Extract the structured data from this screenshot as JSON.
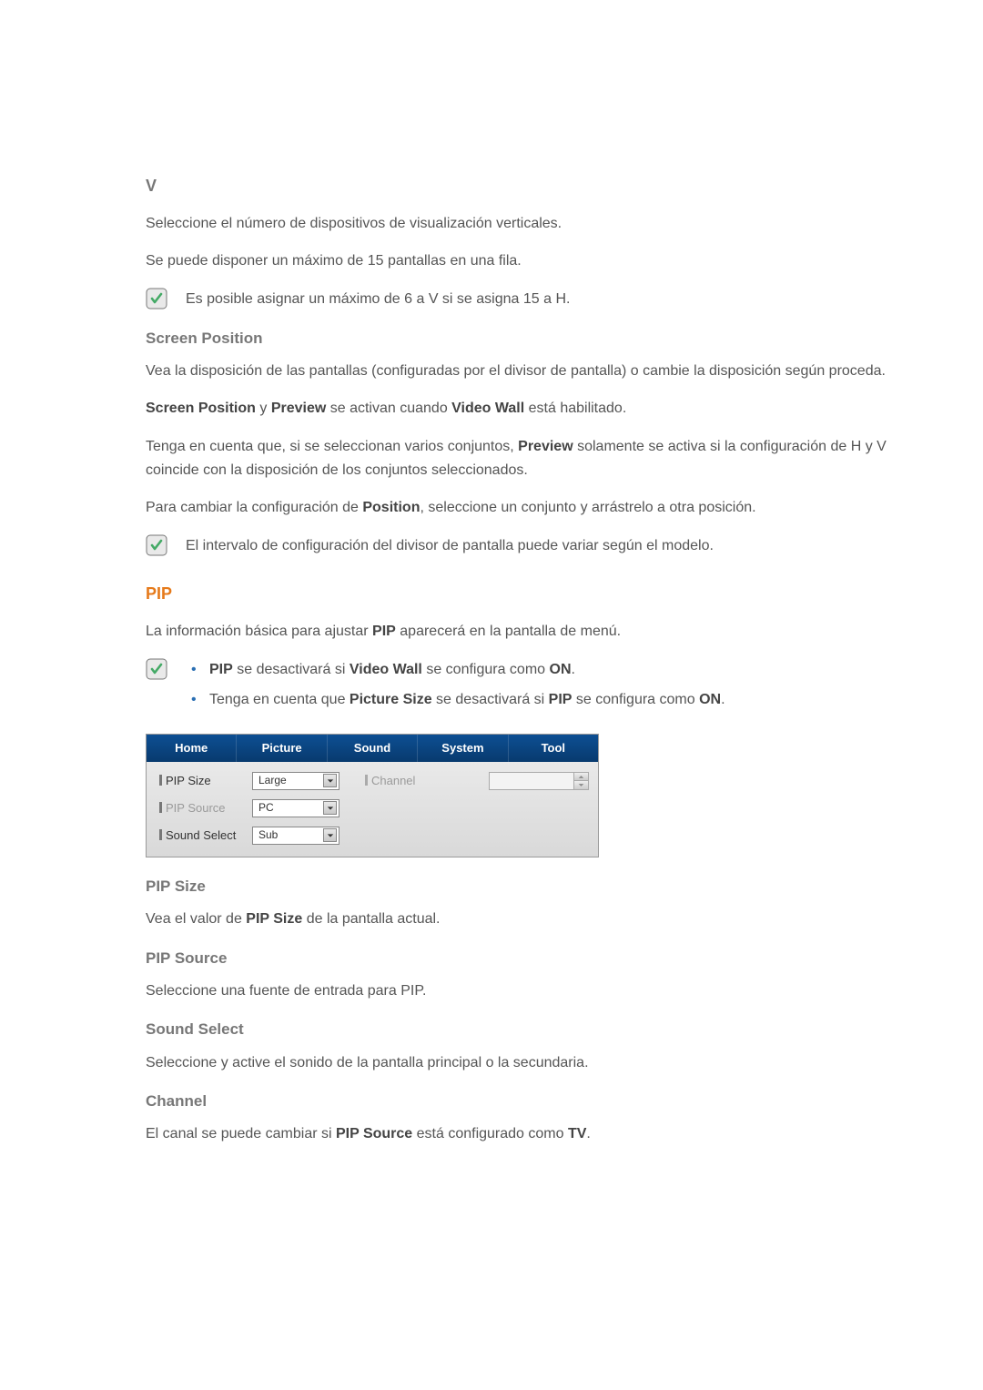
{
  "section_v": {
    "title": "V",
    "p1": "Seleccione el número de dispositivos de visualización verticales.",
    "p2": "Se puede disponer un máximo de 15 pantallas en una fila.",
    "note": "Es posible asignar un máximo de 6 a V si se asigna 15 a H."
  },
  "screen_position": {
    "title": "Screen Position",
    "p1": "Vea la disposición de las pantallas (configuradas por el divisor de pantalla) o cambie la disposición según proceda.",
    "p2_pre": "",
    "p2": "Screen Position y Preview se activan cuando Video Wall está habilitado.",
    "p3": "Tenga en cuenta que, si se seleccionan varios conjuntos, Preview solamente se activa si la configuración de H y V coincide con la disposición de los conjuntos seleccionados.",
    "p4": "Para cambiar la configuración de Position, seleccione un conjunto y arrástrelo a otra posición.",
    "note": "El intervalo de configuración del divisor de pantalla puede variar según el modelo.",
    "bold": {
      "sp": "Screen Position",
      "pv": "Preview",
      "vw": "Video Wall",
      "pos": "Position"
    }
  },
  "pip": {
    "title": "PIP",
    "intro": "La información básica para ajustar PIP aparecerá en la pantalla de menú.",
    "b_pip": "PIP",
    "bullets": {
      "b1_pre": "",
      "b1": "PIP se desactivará si Video Wall se configura como ON.",
      "b2": "Tenga en cuenta que Picture Size se desactivará si PIP se configura como ON."
    },
    "bold": {
      "pip": "PIP",
      "vw": "Video Wall",
      "on": "ON",
      "ps": "Picture Size"
    }
  },
  "panel": {
    "tabs": [
      "Home",
      "Picture",
      "Sound",
      "System",
      "Tool"
    ],
    "rows": {
      "pip_size": {
        "label": "PIP Size",
        "value": "Large"
      },
      "pip_source": {
        "label": "PIP Source",
        "value": "PC"
      },
      "sound_select": {
        "label": "Sound Select",
        "value": "Sub"
      },
      "channel": {
        "label": "Channel"
      }
    }
  },
  "trailing": {
    "pip_size_t": "PIP Size",
    "pip_size_p": "Vea el valor de PIP Size de la pantalla actual.",
    "pip_src_t": "PIP Source",
    "pip_src_p": "Seleccione una fuente de entrada para PIP.",
    "sound_t": "Sound Select",
    "sound_p": "Seleccione y active el sonido de la pantalla principal o la secundaria.",
    "channel_t": "Channel",
    "channel_p": "El canal se puede cambiar si PIP Source está configurado como TV.",
    "bold": {
      "pipsize": "PIP Size",
      "pipsrc": "PIP Source",
      "tv": "TV"
    }
  }
}
